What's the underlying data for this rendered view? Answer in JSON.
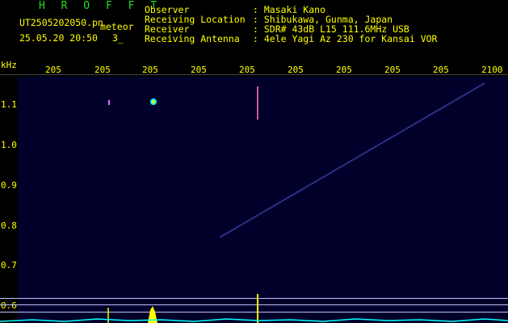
{
  "app": {
    "title": "H R O F F T"
  },
  "file": {
    "name": "UT2505202050.pn",
    "tag": "meteor"
  },
  "stamp": {
    "datetime": "25.05.20 20:50",
    "count": "3_"
  },
  "info": {
    "labels": [
      "Observer",
      "Receiving Location",
      "Receiver",
      "Receiving Antenna"
    ],
    "values": [
      ": Masaki Kano",
      ": Shibukawa, Gunma, Japan",
      ": SDR# 43dB L15 111.6MHz USB",
      ": 4ele Yagi Az 230 for Kansai VOR"
    ]
  },
  "axis": {
    "y_unit": "kHz",
    "y_ticks": [
      "1.1",
      "1.0",
      "0.9",
      "0.8",
      "0.7",
      "0.6"
    ],
    "x_ticks": [
      "205",
      "205",
      "205",
      "205",
      "205",
      "205",
      "205",
      "205",
      "205",
      "2100"
    ]
  },
  "colors": {
    "text": "#ffff00",
    "title": "#22dd22",
    "background": "#00002a",
    "marks": "#ffff00",
    "noise": "#00ffff"
  }
}
